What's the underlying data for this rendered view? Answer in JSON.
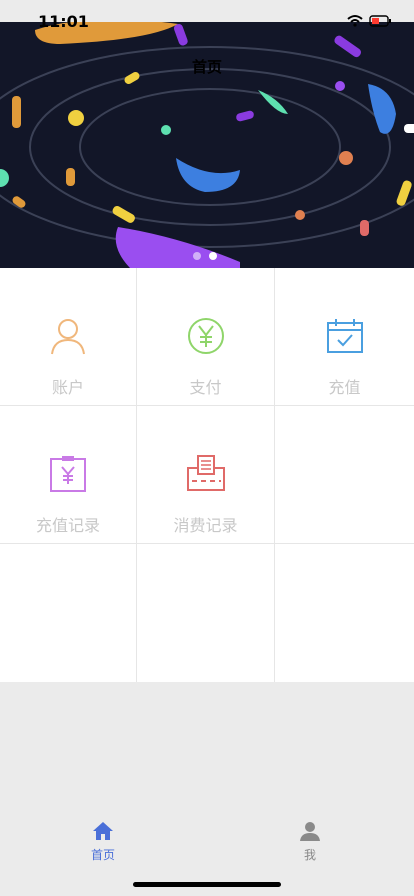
{
  "status_bar": {
    "time": "11:01"
  },
  "header": {
    "title": "首页"
  },
  "banner": {
    "slides": 2,
    "active_slide": 2
  },
  "grid": {
    "items": [
      {
        "label": "账户",
        "icon": "user-icon",
        "color": "#f0b77c"
      },
      {
        "label": "支付",
        "icon": "yen-circle-icon",
        "color": "#8fd56a"
      },
      {
        "label": "充值",
        "icon": "calendar-check-icon",
        "color": "#4a9fe0"
      },
      {
        "label": "充值记录",
        "icon": "yen-clipboard-icon",
        "color": "#c97ae6"
      },
      {
        "label": "消费记录",
        "icon": "receipt-printer-icon",
        "color": "#e06a68"
      }
    ]
  },
  "tabbar": {
    "tabs": [
      {
        "label": "首页",
        "icon": "home-icon",
        "active": true,
        "color": "#4a6fd8"
      },
      {
        "label": "我",
        "icon": "person-icon",
        "active": false,
        "color": "#8a8a8a"
      }
    ]
  }
}
